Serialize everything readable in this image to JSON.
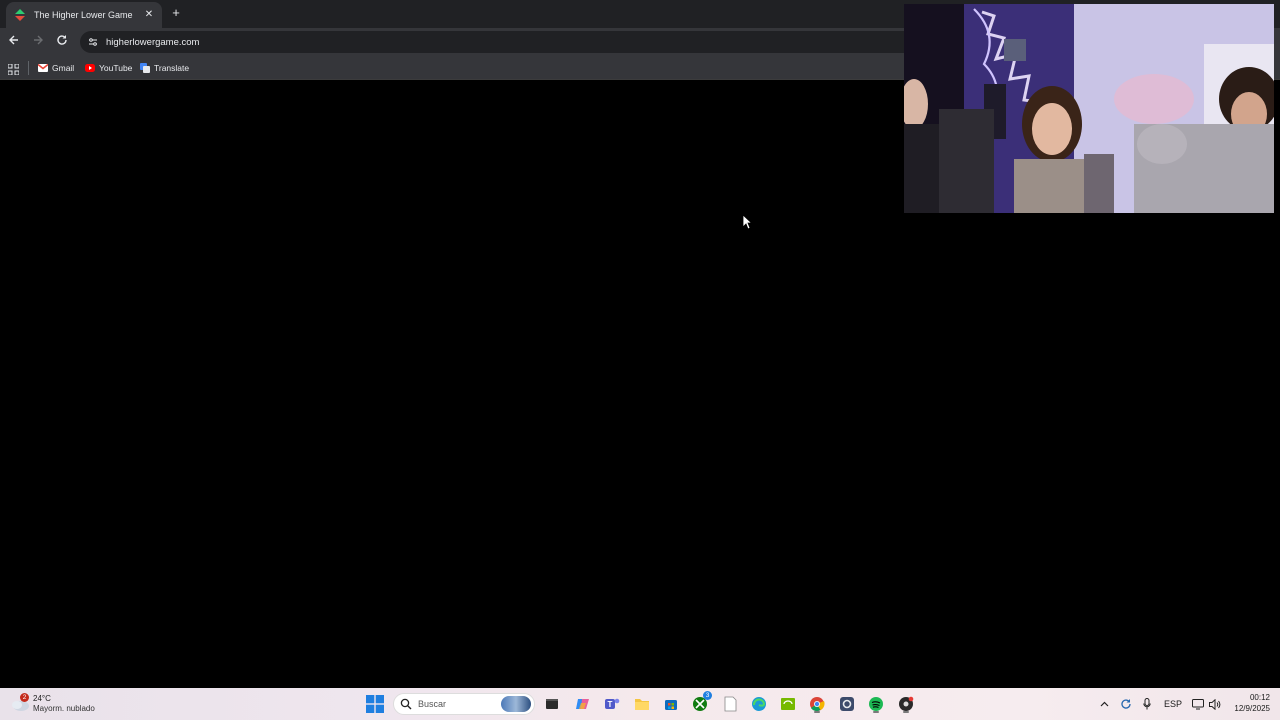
{
  "browser": {
    "tab": {
      "title": "The Higher Lower Game",
      "close": "✕"
    },
    "new_tab": "+",
    "address": {
      "url": "higherlowergame.com"
    },
    "bookmarks": [
      {
        "label": "Gmail",
        "icon": "gmail-icon"
      },
      {
        "label": "YouTube",
        "icon": "youtube-icon"
      },
      {
        "label": "Translate",
        "icon": "translate-icon"
      }
    ]
  },
  "taskbar": {
    "weather": {
      "temp": "24°C",
      "desc": "Mayorm. nublado",
      "badge": "2"
    },
    "search": {
      "label": "Buscar"
    },
    "apps": [
      "file-explorer-dark",
      "copilot",
      "teams",
      "file-explorer",
      "store",
      "xbox",
      "notepad",
      "edge",
      "nvidia",
      "chrome",
      "settings",
      "spotify",
      "media-app"
    ],
    "xbox_badge": "3",
    "tray": {
      "language": "ESP"
    },
    "clock": {
      "time": "00:12",
      "date": "12/9/2025"
    }
  },
  "colors": {
    "tab_strip": "#202124",
    "toolbar": "#35363a",
    "page": "#000000"
  }
}
